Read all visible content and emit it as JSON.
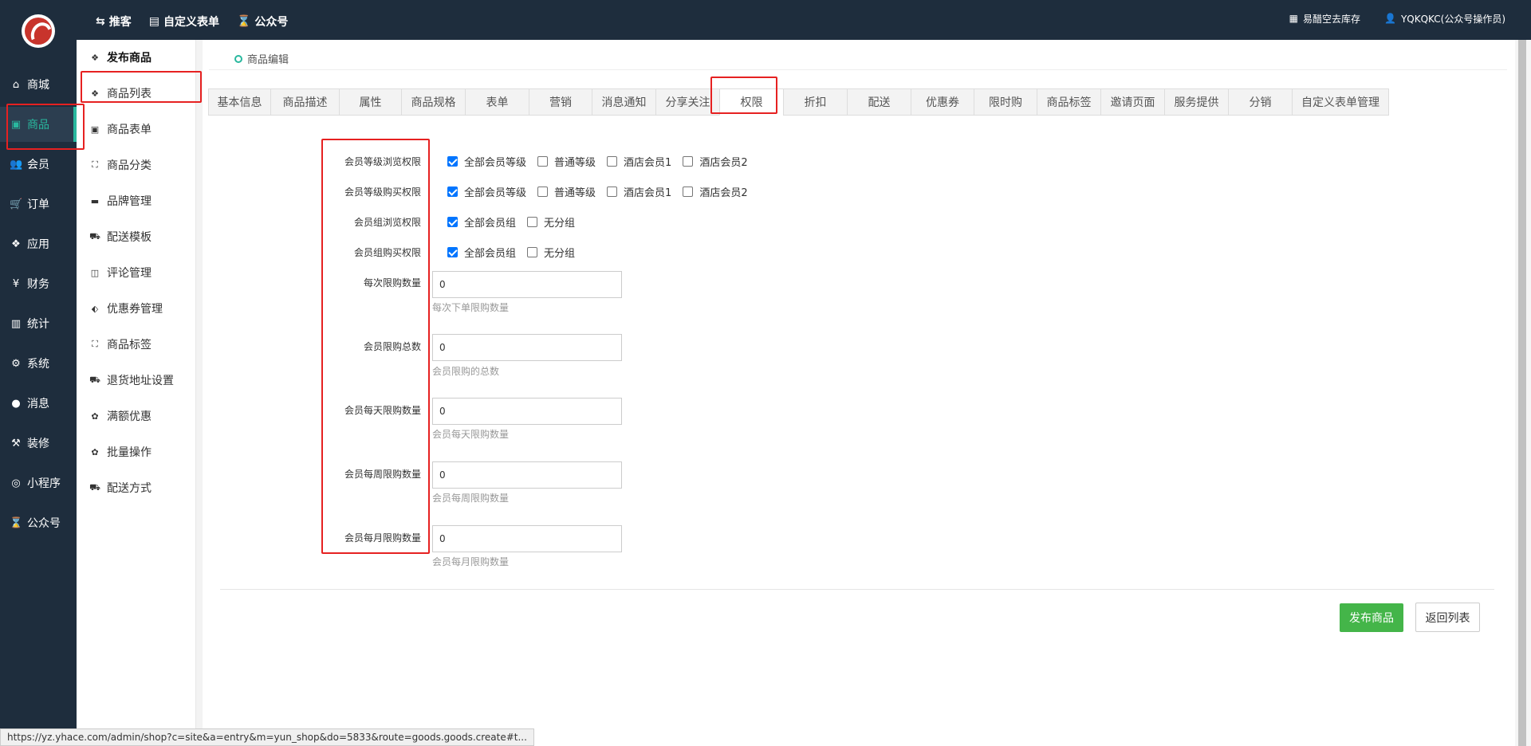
{
  "topbar": {
    "nav": [
      {
        "icon": "share-icon",
        "glyph": "⇆",
        "label": "推客"
      },
      {
        "icon": "form-icon",
        "glyph": "▤",
        "label": "自定义表单"
      },
      {
        "icon": "hourglass-icon",
        "glyph": "⌛",
        "label": "公众号"
      }
    ],
    "right": [
      {
        "icon": "dashboard-icon",
        "glyph": "▦",
        "label": "易醋空去库存"
      },
      {
        "icon": "user-icon",
        "glyph": "👤",
        "label": "YQKQKC(公众号操作员)"
      }
    ]
  },
  "sidebar": {
    "items": [
      {
        "icon": "home-icon",
        "glyph": "⌂",
        "label": "商城"
      },
      {
        "icon": "goods-icon",
        "glyph": "▣",
        "label": "商品"
      },
      {
        "icon": "users-icon",
        "glyph": "👥",
        "label": "会员"
      },
      {
        "icon": "cart-icon",
        "glyph": "🛒",
        "label": "订单"
      },
      {
        "icon": "apps-icon",
        "glyph": "❖",
        "label": "应用"
      },
      {
        "icon": "yen-icon",
        "glyph": "¥",
        "label": "财务"
      },
      {
        "icon": "bar-chart-icon",
        "glyph": "▥",
        "label": "统计"
      },
      {
        "icon": "cogs-icon",
        "glyph": "⚙",
        "label": "系统"
      },
      {
        "icon": "message-icon",
        "glyph": "●",
        "label": "消息"
      },
      {
        "icon": "gavel-icon",
        "glyph": "⚒",
        "label": "装修"
      },
      {
        "icon": "wechat-icon",
        "glyph": "◎",
        "label": "小程序"
      },
      {
        "icon": "hourglass-icon",
        "glyph": "⌛",
        "label": "公众号"
      }
    ],
    "active_index": 1
  },
  "subsidebar": {
    "items": [
      {
        "icon": "cubes-icon",
        "glyph": "❖",
        "label": "发布商品"
      },
      {
        "icon": "cubes-icon",
        "glyph": "❖",
        "label": "商品列表"
      },
      {
        "icon": "file-icon",
        "glyph": "▣",
        "label": "商品表单"
      },
      {
        "icon": "sitemap-icon",
        "glyph": "⛶",
        "label": "商品分类"
      },
      {
        "icon": "briefcase-icon",
        "glyph": "▬",
        "label": "品牌管理"
      },
      {
        "icon": "truck-icon",
        "glyph": "⛟",
        "label": "配送模板"
      },
      {
        "icon": "columns-icon",
        "glyph": "◫",
        "label": "评论管理"
      },
      {
        "icon": "tags-icon",
        "glyph": "⬖",
        "label": "优惠券管理"
      },
      {
        "icon": "sitemap-icon",
        "glyph": "⛶",
        "label": "商品标签"
      },
      {
        "icon": "truck-icon",
        "glyph": "⛟",
        "label": "退货地址设置"
      },
      {
        "icon": "gift-icon",
        "glyph": "✿",
        "label": "满额优惠"
      },
      {
        "icon": "gift-icon",
        "glyph": "✿",
        "label": "批量操作"
      },
      {
        "icon": "truck-icon",
        "glyph": "⛟",
        "label": "配送方式"
      }
    ]
  },
  "breadcrumb": "商品编辑",
  "tabs": [
    "基本信息",
    "商品描述",
    "属性",
    "商品规格",
    "表单",
    "营销",
    "消息通知",
    "分享关注",
    "权限",
    "折扣",
    "配送",
    "优惠券",
    "限时购",
    "商品标签",
    "邀请页面",
    "服务提供",
    "分销",
    "自定义表单管理"
  ],
  "active_tab": "权限",
  "permissions": {
    "level_browse": {
      "label": "会员等级浏览权限",
      "options": [
        {
          "label": "全部会员等级",
          "checked": true
        },
        {
          "label": "普通等级",
          "checked": false
        },
        {
          "label": "酒店会员1",
          "checked": false
        },
        {
          "label": "酒店会员2",
          "checked": false
        }
      ]
    },
    "level_buy": {
      "label": "会员等级购买权限",
      "options": [
        {
          "label": "全部会员等级",
          "checked": true
        },
        {
          "label": "普通等级",
          "checked": false
        },
        {
          "label": "酒店会员1",
          "checked": false
        },
        {
          "label": "酒店会员2",
          "checked": false
        }
      ]
    },
    "group_browse": {
      "label": "会员组浏览权限",
      "options": [
        {
          "label": "全部会员组",
          "checked": true
        },
        {
          "label": "无分组",
          "checked": false
        }
      ]
    },
    "group_buy": {
      "label": "会员组购买权限",
      "options": [
        {
          "label": "全部会员组",
          "checked": true
        },
        {
          "label": "无分组",
          "checked": false
        }
      ]
    }
  },
  "limits": [
    {
      "label": "每次限购数量",
      "value": "0",
      "hint": "每次下单限购数量"
    },
    {
      "label": "会员限购总数",
      "value": "0",
      "hint": "会员限购的总数"
    },
    {
      "label": "会员每天限购数量",
      "value": "0",
      "hint": "会员每天限购数量"
    },
    {
      "label": "会员每周限购数量",
      "value": "0",
      "hint": "会员每周限购数量"
    },
    {
      "label": "会员每月限购数量",
      "value": "0",
      "hint": "会员每月限购数量"
    }
  ],
  "buttons": {
    "publish": "发布商品",
    "back": "返回列表"
  },
  "status_url": "https://yz.yhace.com/admin/shop?c=site&a=entry&m=yun_shop&do=5833&route=goods.goods.create#t...",
  "colors": {
    "sidebar_bg": "#1e2d3d",
    "accent": "#29b89e",
    "publish_btn": "#44b549",
    "annotation_red": "#e62121"
  }
}
